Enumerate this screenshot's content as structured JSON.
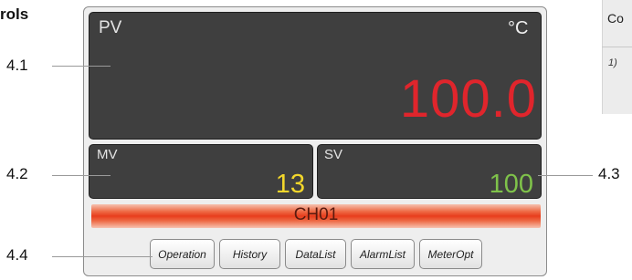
{
  "section_title": "rols",
  "table_fragment": {
    "header": "Co",
    "footnote": "1)"
  },
  "device": {
    "pv": {
      "label": "PV",
      "unit": "°C",
      "value": "100.0"
    },
    "mv": {
      "label": "MV",
      "value": "13"
    },
    "sv": {
      "label": "SV",
      "value": "100"
    },
    "channel": "CH01",
    "buttons": [
      "Operation",
      "History",
      "DataList",
      "AlarmList",
      "MeterOpt"
    ],
    "colors": {
      "pv_value": "#e0252c",
      "mv_value": "#f3d72b",
      "sv_value": "#7fc24a",
      "panel_bg": "#3f3f3f"
    }
  },
  "callouts": [
    "4.1",
    "4.2",
    "4.3",
    "4.4"
  ]
}
